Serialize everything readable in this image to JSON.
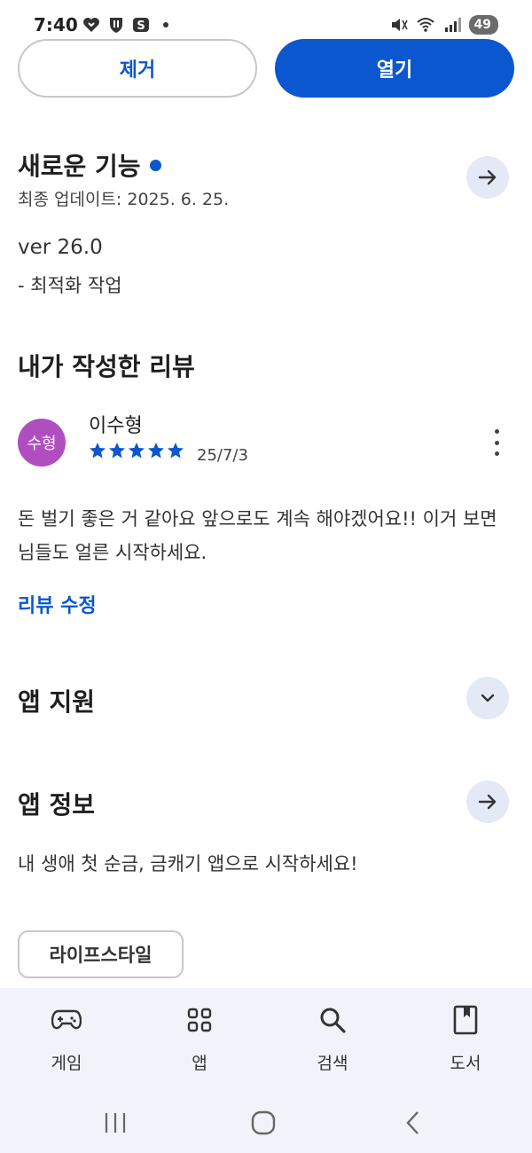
{
  "status": {
    "time": "7:40",
    "battery": "49"
  },
  "actions": {
    "remove_label": "제거",
    "open_label": "열기"
  },
  "whats_new": {
    "title": "새로운 기능",
    "updated": "최종 업데이트: 2025. 6. 25.",
    "version": "ver 26.0",
    "note": "- 최적화 작업"
  },
  "my_review": {
    "title": "내가 작성한 리뷰",
    "avatar_text": "수형",
    "reviewer": "이수형",
    "rating": 5,
    "date": "25/7/3",
    "text": "돈 벌기 좋은 거 같아요 앞으로도 계속 해야겠어요!! 이거 보면 님들도 얼른 시작하세요.",
    "edit_label": "리뷰 수정"
  },
  "app_support": {
    "title": "앱 지원"
  },
  "app_info": {
    "title": "앱 정보",
    "description": "내 생애 첫 순금, 금캐기 앱으로 시작하세요!",
    "category": "라이프스타일"
  },
  "bottom_nav": {
    "items": [
      {
        "label": "게임",
        "icon": "gamepad-icon"
      },
      {
        "label": "앱",
        "icon": "apps-grid-icon"
      },
      {
        "label": "검색",
        "icon": "search-icon"
      },
      {
        "label": "도서",
        "icon": "book-icon"
      }
    ]
  },
  "colors": {
    "accent": "#0b57d0",
    "avatar": "#b04ec0",
    "nav_bg": "#f0f3fa"
  }
}
